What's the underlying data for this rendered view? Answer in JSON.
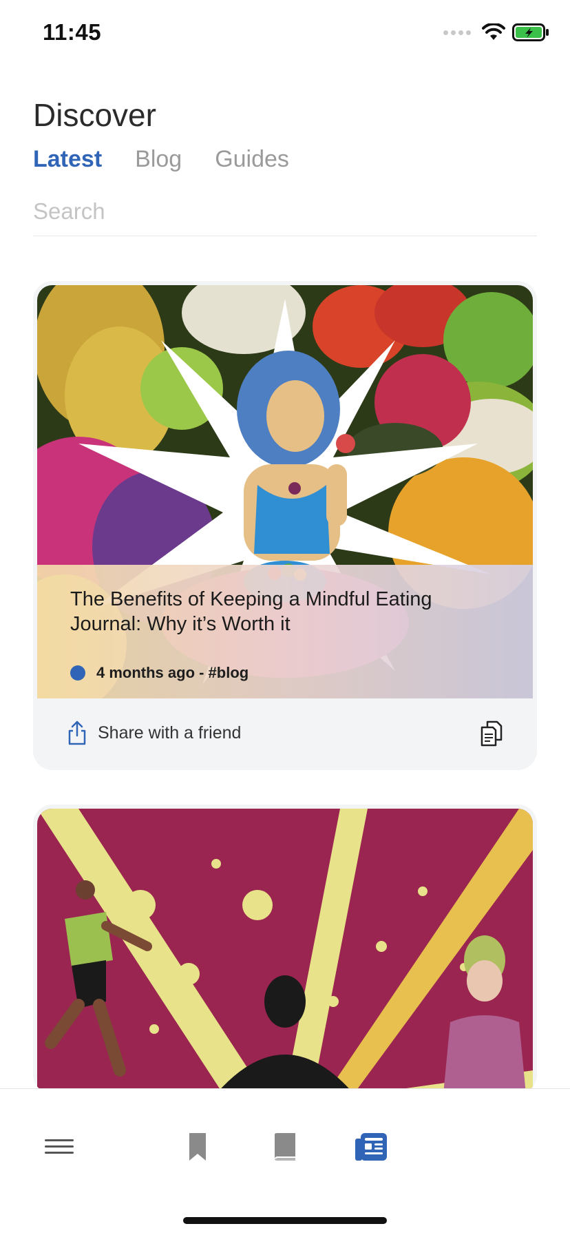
{
  "status_bar": {
    "time": "11:45"
  },
  "header": {
    "title": "Discover",
    "tabs": [
      {
        "label": "Latest",
        "active": true
      },
      {
        "label": "Blog",
        "active": false
      },
      {
        "label": "Guides",
        "active": false
      }
    ],
    "search": {
      "placeholder": "Search",
      "value": ""
    }
  },
  "cards": [
    {
      "title": "The Benefits of Keeping a Mindful Eating Journal: Why it’s Worth it",
      "meta": "4 months ago - #blog",
      "share_label": "Share with a friend",
      "image_icon": "mindful-eating-illustration"
    },
    {
      "image_icon": "running-people-illustration"
    }
  ],
  "bottom_nav": [
    {
      "icon": "menu-icon",
      "active": false
    },
    {
      "icon": "bookmark-icon",
      "active": false
    },
    {
      "icon": "book-icon",
      "active": false
    },
    {
      "icon": "news-icon",
      "active": true
    }
  ],
  "colors": {
    "accent": "#2f64b6",
    "inactive": "#8a8a8a"
  }
}
